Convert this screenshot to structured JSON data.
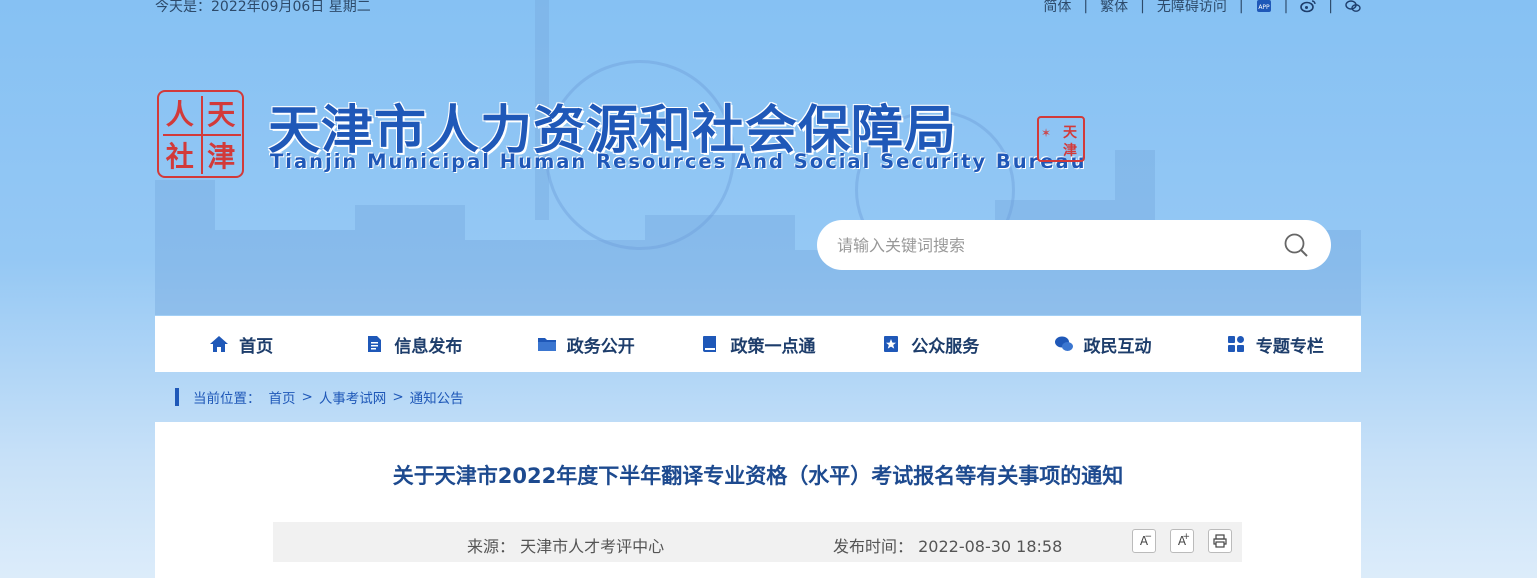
{
  "topbar": {
    "date_label": "今天是：2022年09月06日 星期二",
    "links": [
      "简体",
      "繁体",
      "无障碍访问"
    ],
    "icons": [
      "app-icon",
      "weibo-icon",
      "wechat-icon"
    ]
  },
  "header": {
    "seal_chars": [
      "人",
      "天",
      "社",
      "津"
    ],
    "title": "天津市人力资源和社会保障局",
    "subtitle": "Tianjin Municipal Human Resources And Social Security Bureau",
    "small_seal_chars": [
      "天",
      "津"
    ]
  },
  "search": {
    "placeholder": "请输入关键词搜索"
  },
  "nav": {
    "items": [
      {
        "label": "首页",
        "icon": "home-icon"
      },
      {
        "label": "信息发布",
        "icon": "document-icon"
      },
      {
        "label": "政务公开",
        "icon": "folder-icon"
      },
      {
        "label": "政策一点通",
        "icon": "book-icon"
      },
      {
        "label": "公众服务",
        "icon": "star-badge-icon"
      },
      {
        "label": "政民互动",
        "icon": "chat-icon"
      },
      {
        "label": "专题专栏",
        "icon": "grid-icon"
      }
    ]
  },
  "breadcrumb": {
    "label": "当前位置：",
    "items": [
      "首页",
      "人事考试网",
      "通知公告"
    ],
    "separator": ">"
  },
  "article": {
    "title": "关于天津市2022年度下半年翻译专业资格（水平）考试报名等有关事项的通知",
    "source_label": "来源：",
    "source": "天津市人才考评中心",
    "time_label": "发布时间：",
    "time": "2022-08-30 18:58",
    "tools": {
      "font_down": "A",
      "font_down_sup": "−",
      "font_up": "A",
      "font_up_sup": "+"
    }
  },
  "colors": {
    "accent": "#1f58b8",
    "seal_red": "#d23a3a",
    "nav_text": "#1d3d6b",
    "title_text": "#1d4a8f"
  }
}
